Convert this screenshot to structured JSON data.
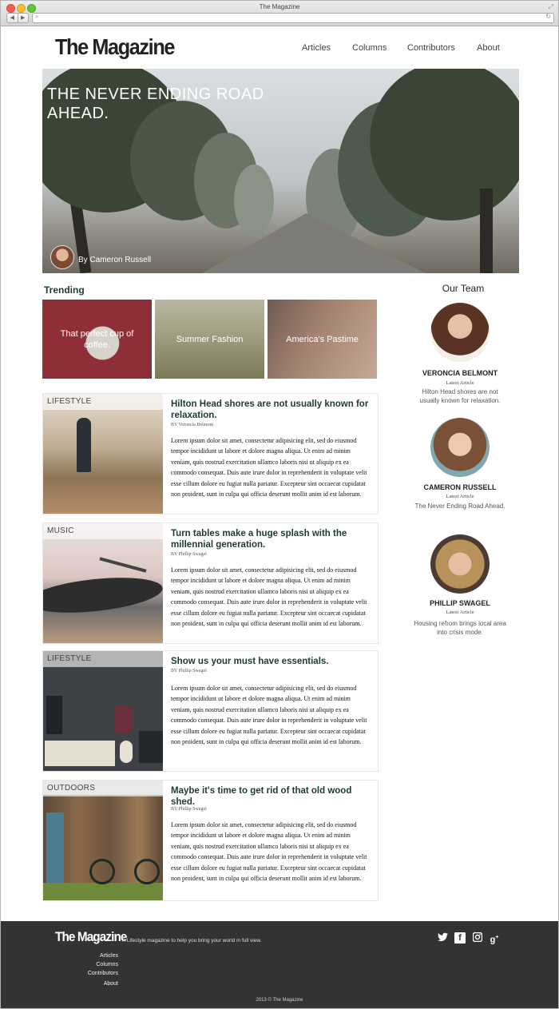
{
  "window": {
    "title": "The Magazine"
  },
  "site": {
    "logo": "The Magazine",
    "nav": [
      "Articles",
      "Columns",
      "Contributors",
      "About"
    ]
  },
  "hero": {
    "title": "THE NEVER ENDING ROAD AHEAD.",
    "byline": "By Cameron Russell"
  },
  "trending": {
    "heading": "Trending",
    "items": [
      {
        "label": "That perfect cup of coffee."
      },
      {
        "label": "Summer Fashion"
      },
      {
        "label": "America's Pastime"
      }
    ]
  },
  "articles": [
    {
      "category": "LIFESTYLE",
      "title": "Hilton Head shores are not usually known for relaxation.",
      "byline": "BY Veroncia Belmont",
      "body": "Lorem ipsum dolor sit amet, consectetur adipisicing elit, sed do eiusmod tempor incididunt ut labore et dolore magna aliqua. Ut enim ad minim veniam, quis nostrud exercitation ullamco laboris nisi ut aliquip ex ea commodo consequat. Duis aute irure dolor in reprehenderit in voluptate velit esse cillum dolore eu fugiat nulla pariatur. Excepteur sint occaecat cupidatat non proident, sunt in culpa qui officia deserunt mollit anim id est laborum."
    },
    {
      "category": "MUSIC",
      "title": "Turn tables make a huge splash with the millennial generation.",
      "byline": "BY Phillip Swagel",
      "body": "Lorem ipsum dolor sit amet, consectetur adipisicing elit, sed do eiusmod tempor incididunt ut labore et dolore magna aliqua. Ut enim ad minim veniam, quis nostrud exercitation ullamco laboris nisi ut aliquip ex ea commodo consequat. Duis aute irure dolor in reprehenderit in voluptate velit esse cillum dolore eu fugiat nulla pariatur. Excepteur sint occaecat cupidatat non proident, sunt in culpa qui officia deserunt mollit anim id est laborum."
    },
    {
      "category": "LIFESTYLE",
      "title": "Show us your must have essentials.",
      "byline": "BY Phillip Swagel",
      "body": "Lorem ipsum dolor sit amet, consectetur adipisicing elit, sed do eiusmod tempor incididunt ut labore et dolore magna aliqua. Ut enim ad minim veniam, quis nostrud exercitation ullamco laboris nisi ut aliquip ex ea commodo consequat. Duis aute irure dolor in reprehenderit in voluptate velit esse cillum dolore eu fugiat nulla pariatur. Excepteur sint occaecat cupidatat non proident, sunt in culpa qui officia deserunt mollit anim id est laborum."
    },
    {
      "category": "OUTDOORS",
      "title": "Maybe it's time to get rid of that old wood shed.",
      "byline": "BY Phillip Swagel",
      "body": "Lorem ipsum dolor sit amet, consectetur adipisicing elit, sed do eiusmod tempor incididunt ut labore et dolore magna aliqua. Ut enim ad minim veniam, quis nostrud exercitation ullamco laboris nisi ut aliquip ex ea commodo consequat. Duis aute irure dolor in reprehenderit in voluptate velit esse cillum dolore eu fugiat nulla pariatur. Excepteur sint occaecat cupidatat non proident, sunt in culpa qui officia deserunt mollit anim id est laborum."
    }
  ],
  "team": {
    "heading": "Our Team",
    "members": [
      {
        "name": "VERONCIA BELMONT",
        "sub": "Latest Article",
        "article": "Hilton Head shores are not usually known for relaxation."
      },
      {
        "name": "CAMERON RUSSELL",
        "sub": "Latest Article",
        "article": "The Never Ending Road Ahead."
      },
      {
        "name": "PHILLIP SWAGEL",
        "sub": "Latest Article",
        "article": "Housing refrom brings local area into crisis mode."
      }
    ]
  },
  "footer": {
    "logo": "The Magazine",
    "tagline": "A Lifestyle magazine to help you bring your world in full view.",
    "links": [
      "Articles",
      "Columns",
      "Contributors",
      "About"
    ],
    "social_icons": [
      "twitter-icon",
      "facebook-icon",
      "instagram-icon",
      "google-plus-icon"
    ],
    "copyright": "2013 © The Magazine"
  }
}
